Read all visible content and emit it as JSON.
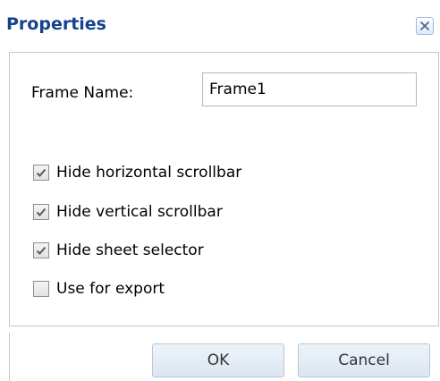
{
  "dialog": {
    "title": "Properties",
    "close_icon": "close-icon"
  },
  "form": {
    "frame_name_label": "Frame Name:",
    "frame_name_value": "Frame1",
    "checkboxes": [
      {
        "label": "Hide horizontal scrollbar",
        "checked": true
      },
      {
        "label": "Hide vertical scrollbar",
        "checked": true
      },
      {
        "label": "Hide sheet selector",
        "checked": true
      },
      {
        "label": "Use for export",
        "checked": false
      }
    ]
  },
  "buttons": {
    "ok_label": "OK",
    "cancel_label": "Cancel"
  },
  "colors": {
    "title": "#15428b",
    "border": "#c5c5c5",
    "button_border": "#b6c7d9"
  }
}
